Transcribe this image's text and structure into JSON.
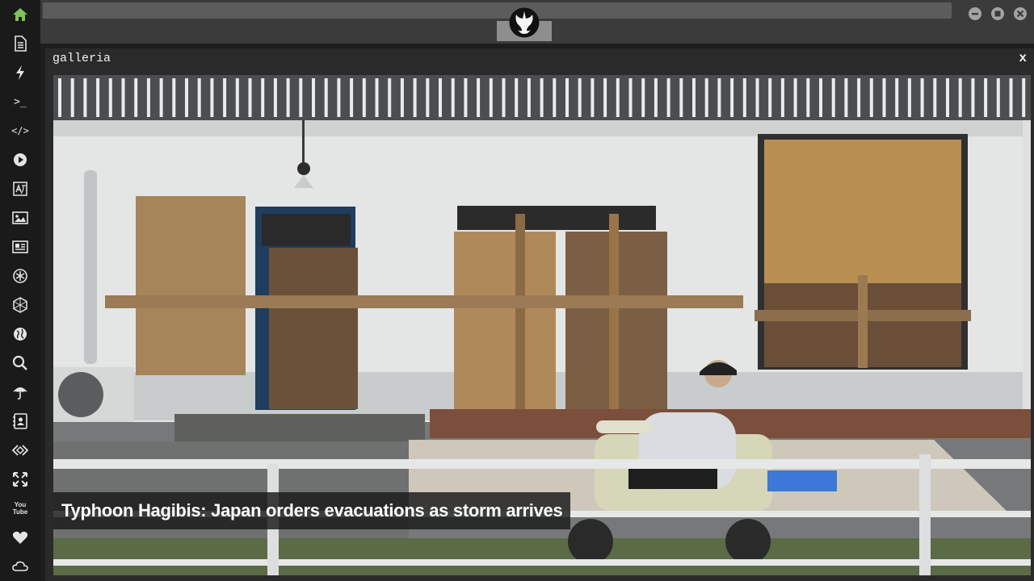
{
  "sidebar": {
    "items": [
      {
        "icon": "home-icon"
      },
      {
        "icon": "document-icon"
      },
      {
        "icon": "lightning-icon"
      },
      {
        "icon": "terminal-icon",
        "label": ">_"
      },
      {
        "icon": "code-icon",
        "label": "</>"
      },
      {
        "icon": "play-icon"
      },
      {
        "icon": "translate-icon"
      },
      {
        "icon": "image-icon"
      },
      {
        "icon": "news-icon"
      },
      {
        "icon": "asterisk-icon"
      },
      {
        "icon": "hexagon-icon"
      },
      {
        "icon": "globe-icon"
      },
      {
        "icon": "search-icon"
      },
      {
        "icon": "umbrella-icon"
      },
      {
        "icon": "contact-icon"
      },
      {
        "icon": "embed-icon"
      },
      {
        "icon": "expand-icon"
      },
      {
        "icon": "youtube-icon",
        "label": "You Tube"
      },
      {
        "icon": "heart-icon"
      },
      {
        "icon": "cloud-icon"
      }
    ],
    "active_color": "#7fc35a"
  },
  "topbar": {
    "logo_icon": "rebel-alliance-icon"
  },
  "window_controls": {
    "minimize_icon": "minimize-icon",
    "maximize_icon": "maximize-icon",
    "close_icon": "close-icon"
  },
  "panel": {
    "title": "galleria",
    "close_label": "x"
  },
  "gallery": {
    "caption": "Typhoon Hagibis: Japan orders evacuations as storm arrives"
  }
}
